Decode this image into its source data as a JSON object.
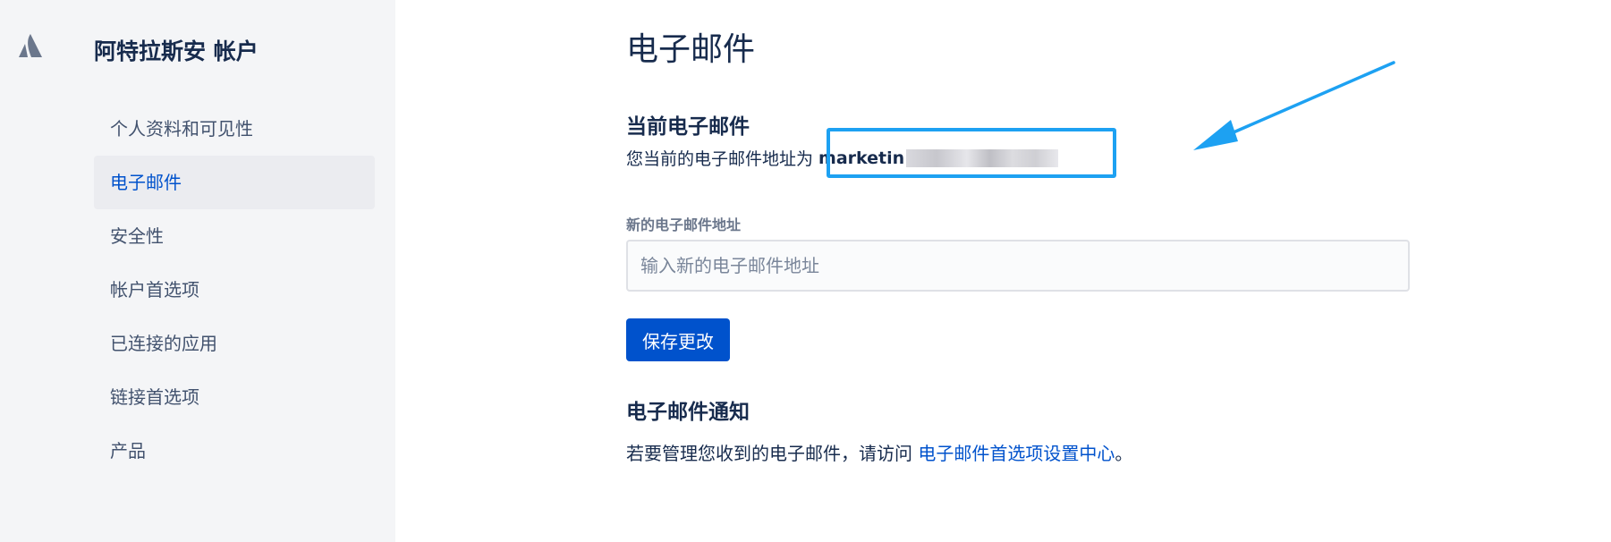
{
  "sidebar": {
    "logo_icon": "atlassian-logo-icon",
    "title": "阿特拉斯安 帐户",
    "items": [
      {
        "label": "个人资料和可见性",
        "active": false
      },
      {
        "label": "电子邮件",
        "active": true
      },
      {
        "label": "安全性",
        "active": false
      },
      {
        "label": "帐户首选项",
        "active": false
      },
      {
        "label": "已连接的应用",
        "active": false
      },
      {
        "label": "链接首选项",
        "active": false
      },
      {
        "label": "产品",
        "active": false
      }
    ]
  },
  "main": {
    "page_title": "电子邮件",
    "current_section": {
      "heading": "当前电子邮件",
      "prefix_text": "您当前的电子邮件地址为",
      "email_visible": "marketin"
    },
    "new_email": {
      "label": "新的电子邮件地址",
      "placeholder": "输入新的电子邮件地址",
      "value": ""
    },
    "save_label": "保存更改",
    "notifications": {
      "heading": "电子邮件通知",
      "text_before": "若要管理您收到的电子邮件，请访问 ",
      "link_text": "电子邮件首选项设置中心",
      "text_after": "。"
    }
  },
  "annotation": {
    "highlight_color": "#1da1f2",
    "arrow_color": "#1da1f2"
  },
  "colors": {
    "accent": "#0052cc",
    "sidebar_bg": "#f4f5f7",
    "text_primary": "#172b4d"
  }
}
